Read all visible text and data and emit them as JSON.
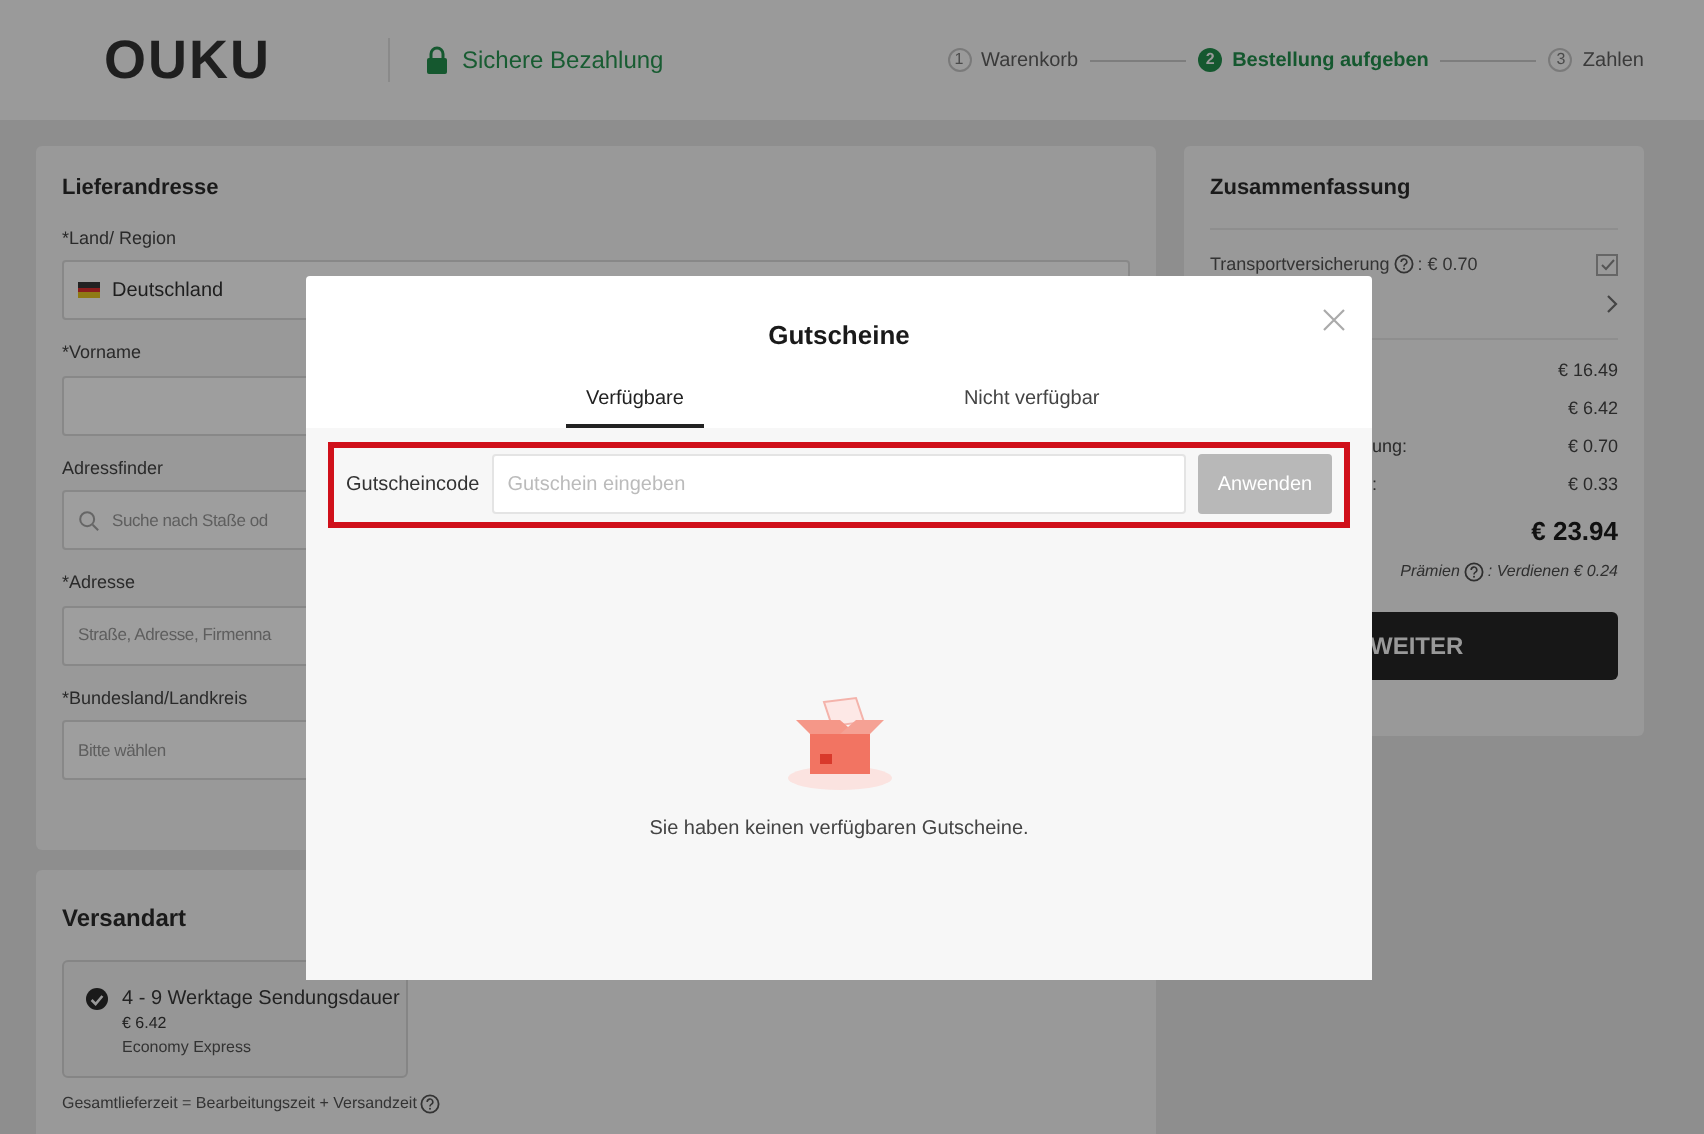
{
  "header": {
    "logo": "OUKU",
    "secure_label": "Sichere Bezahlung",
    "steps": [
      {
        "number": "1",
        "label": "Warenkorb",
        "active": false
      },
      {
        "number": "2",
        "label": "Bestellung aufgeben",
        "active": true
      },
      {
        "number": "3",
        "label": "Zahlen",
        "active": false
      }
    ]
  },
  "address": {
    "title": "Lieferandresse",
    "fields": [
      {
        "kind": "country",
        "label": "*Land/ Region",
        "value": "Deutschland"
      },
      {
        "kind": "text",
        "label": "*Vorname"
      },
      {
        "kind": "search",
        "label": "Adressfinder",
        "placeholder": "Suche nach Staße od"
      },
      {
        "kind": "text",
        "label": "*Adresse",
        "placeholder": "Straße, Adresse, Firmenna"
      },
      {
        "kind": "text",
        "label": "*Bundesland/Landkreis",
        "placeholder": "Bitte wählen"
      }
    ]
  },
  "shipping": {
    "title": "Versandart",
    "options": [
      {
        "selected": true,
        "title": "4 - 9 Werktage Sendungsdauer",
        "price": "€ 6.42",
        "carrier": "Economy Express"
      }
    ],
    "note": "Gesamtlieferzeit = Bearbeitungszeit + Versandzeit"
  },
  "summary": {
    "title": "Zusammenfassung",
    "insurance": {
      "label": "Transportversicherung",
      "price": ": € 0.70",
      "checked": true
    },
    "rows": [
      {
        "value": "€ 16.49"
      },
      {
        "value": "€ 6.42"
      },
      {
        "label": "ung:",
        "value": "€ 0.70"
      },
      {
        "label": ":",
        "value": "€ 0.33"
      }
    ],
    "total": "€ 23.94",
    "rewards_label": "Prämien",
    "rewards_text": ": Verdienen € 0.24",
    "button": "WEITER"
  },
  "dialog": {
    "title": "Gutscheine",
    "tabs": [
      {
        "label": "Verfügbare",
        "selected": true
      },
      {
        "label": "Nicht verfügbar",
        "selected": false
      }
    ],
    "code_label": "Gutscheincode",
    "code_placeholder": "Gutschein eingeben",
    "apply_button": {
      "label": "Anwenden",
      "disabled": true
    },
    "empty_message": "Sie haben keinen verfügbaren Gutscheine."
  }
}
